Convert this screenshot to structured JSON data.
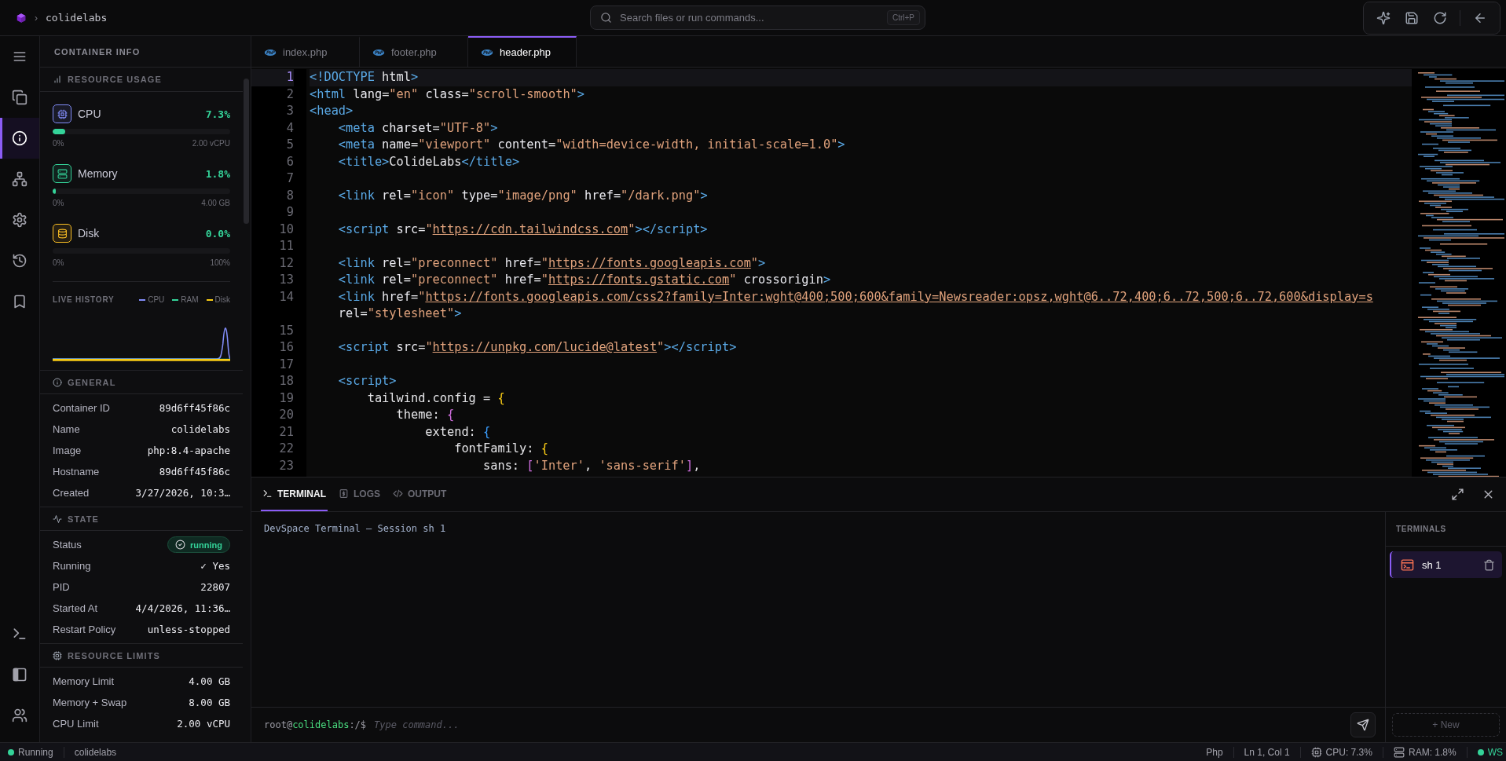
{
  "top_bar": {
    "separator": "›",
    "project": "colidelabs",
    "search": {
      "placeholder": "Search files or run commands...",
      "shortcut": "Ctrl+P"
    },
    "actions": [
      {
        "kind": "sparkles"
      },
      {
        "kind": "save"
      },
      {
        "kind": "refresh"
      },
      {
        "kind": "back"
      }
    ]
  },
  "activity_bar": {
    "top": [
      {
        "kind": "menu",
        "selected": false
      },
      {
        "kind": "files",
        "selected": false
      },
      {
        "kind": "info",
        "selected": true
      },
      {
        "kind": "network",
        "selected": false
      },
      {
        "kind": "settings",
        "selected": false
      },
      {
        "kind": "history",
        "selected": false
      },
      {
        "kind": "bookmark",
        "selected": false
      }
    ],
    "bottom": [
      {
        "kind": "terminal",
        "selected": false
      },
      {
        "kind": "panel",
        "selected": false
      },
      {
        "kind": "users",
        "selected": false
      }
    ]
  },
  "side_panel": {
    "title": "CONTAINER INFO",
    "sections": [
      {
        "kind": "usage",
        "title": "RESOURCE USAGE",
        "meters": [
          {
            "kind": "cpu",
            "name": "CPU",
            "reading": "7.3%",
            "level": 0.073,
            "min": "0%",
            "max": "2.00 vCPU",
            "color": "#818cf8"
          },
          {
            "kind": "memory",
            "name": "Memory",
            "reading": "1.8%",
            "level": 0.018,
            "min": "0%",
            "max": "4.00 GB",
            "color": "#34d399"
          },
          {
            "kind": "disk",
            "name": "Disk",
            "reading": "0.0%",
            "level": 0,
            "min": "0%",
            "max": "100%",
            "color": "#fbbf24"
          }
        ],
        "history": {
          "title": "LIVE HISTORY",
          "legend": [
            {
              "label": "CPU",
              "color": "#818cf8"
            },
            {
              "label": "RAM",
              "color": "#34d399"
            },
            {
              "label": "Disk",
              "color": "#facc15"
            }
          ]
        }
      },
      {
        "kind": "general",
        "title": "GENERAL",
        "rows": [
          {
            "kind": "text",
            "label": "Container ID",
            "value": "89d6ff45f86c"
          },
          {
            "kind": "text",
            "label": "Name",
            "value": "colidelabs"
          },
          {
            "kind": "text",
            "label": "Image",
            "value": "php:8.4-apache"
          },
          {
            "kind": "text",
            "label": "Hostname",
            "value": "89d6ff45f86c"
          },
          {
            "kind": "text",
            "label": "Created",
            "value": "3/27/2026, 10:3…"
          }
        ]
      },
      {
        "kind": "state",
        "title": "STATE",
        "rows": [
          {
            "kind": "badge",
            "label": "Status",
            "value": "running"
          },
          {
            "kind": "text",
            "label": "Running",
            "value": "✓ Yes"
          },
          {
            "kind": "text",
            "label": "PID",
            "value": "22807"
          },
          {
            "kind": "text",
            "label": "Started At",
            "value": "4/4/2026, 11:36…"
          },
          {
            "kind": "text",
            "label": "Restart Policy",
            "value": "unless-stopped"
          }
        ]
      },
      {
        "kind": "limits",
        "title": "RESOURCE LIMITS",
        "rows": [
          {
            "kind": "text",
            "label": "Memory Limit",
            "value": "4.00 GB"
          },
          {
            "kind": "text",
            "label": "Memory + Swap",
            "value": "8.00 GB"
          },
          {
            "kind": "text",
            "label": "CPU Limit",
            "value": "2.00 vCPU"
          }
        ]
      }
    ]
  },
  "editor": {
    "tabs": [
      {
        "label": "index.php",
        "selected": false
      },
      {
        "label": "footer.php",
        "selected": false
      },
      {
        "label": "header.php",
        "selected": true
      }
    ],
    "lines": [
      {
        "number": "1",
        "current": true,
        "tokens": [
          {
            "kind": "tag",
            "text": "<!DOCTYPE"
          },
          {
            "kind": "text",
            "text": " html"
          },
          {
            "kind": "tag",
            "text": ">"
          }
        ]
      },
      {
        "number": "2",
        "current": false,
        "tokens": [
          {
            "kind": "tag",
            "text": "<html"
          },
          {
            "kind": "attr",
            "text": " lang"
          },
          {
            "kind": "text",
            "text": "="
          },
          {
            "kind": "string",
            "text": "\"en\""
          },
          {
            "kind": "attr",
            "text": " class"
          },
          {
            "kind": "text",
            "text": "="
          },
          {
            "kind": "string",
            "text": "\"scroll-smooth\""
          },
          {
            "kind": "tag",
            "text": ">"
          }
        ]
      },
      {
        "number": "3",
        "current": false,
        "tokens": [
          {
            "kind": "tag",
            "text": "<head>"
          }
        ]
      },
      {
        "number": "4",
        "current": false,
        "tokens": [
          {
            "kind": "tag",
            "text": "    <meta"
          },
          {
            "kind": "attr",
            "text": " charset"
          },
          {
            "kind": "text",
            "text": "="
          },
          {
            "kind": "string",
            "text": "\"UTF-8\""
          },
          {
            "kind": "tag",
            "text": ">"
          }
        ]
      },
      {
        "number": "5",
        "current": false,
        "tokens": [
          {
            "kind": "tag",
            "text": "    <meta"
          },
          {
            "kind": "attr",
            "text": " name"
          },
          {
            "kind": "text",
            "text": "="
          },
          {
            "kind": "string",
            "text": "\"viewport\""
          },
          {
            "kind": "attr",
            "text": " content"
          },
          {
            "kind": "text",
            "text": "="
          },
          {
            "kind": "string",
            "text": "\"width=device-width, initial-scale=1.0\""
          },
          {
            "kind": "tag",
            "text": ">"
          }
        ]
      },
      {
        "number": "6",
        "current": false,
        "tokens": [
          {
            "kind": "tag",
            "text": "    <title>"
          },
          {
            "kind": "text",
            "text": "ColideLabs"
          },
          {
            "kind": "tag",
            "text": "</title>"
          }
        ]
      },
      {
        "number": "7",
        "current": false
      },
      {
        "number": "8",
        "current": false,
        "tokens": [
          {
            "kind": "tag",
            "text": "    <link"
          },
          {
            "kind": "attr",
            "text": " rel"
          },
          {
            "kind": "text",
            "text": "="
          },
          {
            "kind": "string",
            "text": "\"icon\""
          },
          {
            "kind": "attr",
            "text": " type"
          },
          {
            "kind": "text",
            "text": "="
          },
          {
            "kind": "string",
            "text": "\"image/png\""
          },
          {
            "kind": "attr",
            "text": " href"
          },
          {
            "kind": "text",
            "text": "="
          },
          {
            "kind": "string",
            "text": "\"/dark.png\""
          },
          {
            "kind": "tag",
            "text": ">"
          }
        ]
      },
      {
        "number": "9",
        "current": false
      },
      {
        "number": "10",
        "current": false,
        "tokens": [
          {
            "kind": "tag",
            "text": "    <script"
          },
          {
            "kind": "attr",
            "text": " src"
          },
          {
            "kind": "text",
            "text": "="
          },
          {
            "kind": "string",
            "text": "\""
          },
          {
            "kind": "url",
            "text": "https://cdn.tailwindcss.com"
          },
          {
            "kind": "string",
            "text": "\""
          },
          {
            "kind": "tag",
            "text": "></script>"
          }
        ]
      },
      {
        "number": "11",
        "current": false
      },
      {
        "number": "12",
        "current": false,
        "tokens": [
          {
            "kind": "tag",
            "text": "    <link"
          },
          {
            "kind": "attr",
            "text": " rel"
          },
          {
            "kind": "text",
            "text": "="
          },
          {
            "kind": "string",
            "text": "\"preconnect\""
          },
          {
            "kind": "attr",
            "text": " href"
          },
          {
            "kind": "text",
            "text": "="
          },
          {
            "kind": "string",
            "text": "\""
          },
          {
            "kind": "url",
            "text": "https://fonts.googleapis.com"
          },
          {
            "kind": "string",
            "text": "\""
          },
          {
            "kind": "tag",
            "text": ">"
          }
        ]
      },
      {
        "number": "13",
        "current": false,
        "tokens": [
          {
            "kind": "tag",
            "text": "    <link"
          },
          {
            "kind": "attr",
            "text": " rel"
          },
          {
            "kind": "text",
            "text": "="
          },
          {
            "kind": "string",
            "text": "\"preconnect\""
          },
          {
            "kind": "attr",
            "text": " href"
          },
          {
            "kind": "text",
            "text": "="
          },
          {
            "kind": "string",
            "text": "\""
          },
          {
            "kind": "url",
            "text": "https://fonts.gstatic.com"
          },
          {
            "kind": "string",
            "text": "\""
          },
          {
            "kind": "attr",
            "text": " crossorigin"
          },
          {
            "kind": "tag",
            "text": ">"
          }
        ]
      },
      {
        "number": "14",
        "current": false,
        "tokens": [
          {
            "kind": "tag",
            "text": "    <link"
          },
          {
            "kind": "attr",
            "text": " href"
          },
          {
            "kind": "text",
            "text": "="
          },
          {
            "kind": "string",
            "text": "\""
          },
          {
            "kind": "url",
            "text": "https://fonts.googleapis.com/css2?family=Inter:wght@400;500;600&family=Newsreader:opsz,wght@6..72,400;6..72,500;6..72,600&display=s"
          }
        ]
      },
      {
        "current": false,
        "tokens": [
          {
            "kind": "attr",
            "text": "    rel"
          },
          {
            "kind": "text",
            "text": "="
          },
          {
            "kind": "string",
            "text": "\"stylesheet\""
          },
          {
            "kind": "tag",
            "text": ">"
          }
        ]
      },
      {
        "number": "15",
        "current": false
      },
      {
        "number": "16",
        "current": false,
        "tokens": [
          {
            "kind": "tag",
            "text": "    <script"
          },
          {
            "kind": "attr",
            "text": " src"
          },
          {
            "kind": "text",
            "text": "="
          },
          {
            "kind": "string",
            "text": "\""
          },
          {
            "kind": "url",
            "text": "https://unpkg.com/lucide@latest"
          },
          {
            "kind": "string",
            "text": "\""
          },
          {
            "kind": "tag",
            "text": "></script>"
          }
        ]
      },
      {
        "number": "17",
        "current": false
      },
      {
        "number": "18",
        "current": false,
        "tokens": [
          {
            "kind": "tag",
            "text": "    <script>"
          }
        ]
      },
      {
        "number": "19",
        "current": false,
        "tokens": [
          {
            "kind": "text",
            "text": "        tailwind.config = "
          },
          {
            "kind": "bracket",
            "text": "{",
            "color": "#facc15"
          }
        ]
      },
      {
        "number": "20",
        "current": false,
        "tokens": [
          {
            "kind": "text",
            "text": "            theme: "
          },
          {
            "kind": "bracket",
            "text": "{",
            "color": "#d16fe0"
          }
        ]
      },
      {
        "number": "21",
        "current": false,
        "tokens": [
          {
            "kind": "text",
            "text": "                extend: "
          },
          {
            "kind": "bracket",
            "text": "{",
            "color": "#3b9eff"
          }
        ]
      },
      {
        "number": "22",
        "current": false,
        "tokens": [
          {
            "kind": "text",
            "text": "                    fontFamily: "
          },
          {
            "kind": "bracket",
            "text": "{",
            "color": "#facc15"
          }
        ]
      },
      {
        "number": "23",
        "current": false,
        "tokens": [
          {
            "kind": "text",
            "text": "                        sans: "
          },
          {
            "kind": "bracket",
            "text": "[",
            "color": "#d16fe0"
          },
          {
            "kind": "string",
            "text": "'Inter'"
          },
          {
            "kind": "text",
            "text": ", "
          },
          {
            "kind": "string",
            "text": "'sans-serif'"
          },
          {
            "kind": "bracket",
            "text": "]",
            "color": "#d16fe0"
          },
          {
            "kind": "text",
            "text": ","
          }
        ]
      }
    ]
  },
  "terminal": {
    "tabs": [
      {
        "kind": "terminal",
        "label": "TERMINAL",
        "selected": true
      },
      {
        "kind": "logs",
        "label": "LOGS",
        "selected": false
      },
      {
        "kind": "code",
        "label": "OUTPUT",
        "selected": false
      }
    ],
    "output": [
      "DevSpace Terminal — Session sh 1"
    ],
    "prompt": {
      "user": "root@",
      "host": "colidelabs",
      "path": ":/$"
    },
    "input": {
      "placeholder": "Type command..."
    },
    "sessions": {
      "title": "TERMINALS",
      "items": [
        {
          "label": "sh 1",
          "selected": true
        }
      ],
      "new_button": "+ New"
    }
  },
  "status_bar": {
    "left": [
      {
        "kind": "dot",
        "label": "Running"
      },
      {
        "kind": "plain",
        "label": "colidelabs"
      }
    ],
    "right": [
      {
        "kind": "plain",
        "label": "Php"
      },
      {
        "kind": "plain",
        "label": "Ln 1, Col 1"
      },
      {
        "kind": "cpu",
        "label": "CPU: 7.3%"
      },
      {
        "kind": "memory",
        "label": "RAM: 1.8%"
      },
      {
        "kind": "dot",
        "label": "WS"
      }
    ]
  }
}
